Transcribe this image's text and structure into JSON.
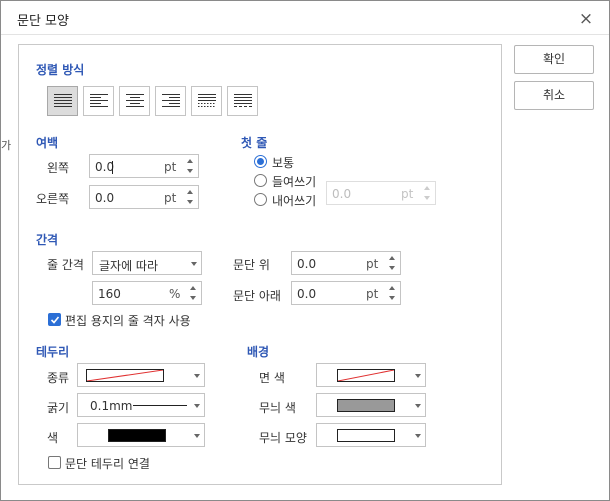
{
  "dialog": {
    "title": "문단 모양",
    "close_icon": "×"
  },
  "buttons": {
    "ok": "확인",
    "cancel": "취소"
  },
  "alignment": {
    "heading": "정렬 방식",
    "options": [
      "justify",
      "left",
      "center",
      "right",
      "distribute",
      "divide"
    ],
    "selected": "justify"
  },
  "margin": {
    "heading": "여백",
    "left": {
      "label": "왼쪽",
      "value": "0.0",
      "unit": "pt"
    },
    "right": {
      "label": "오른쪽",
      "value": "0.0",
      "unit": "pt"
    }
  },
  "first_line": {
    "heading": "첫 줄",
    "options": [
      "보통",
      "들여쓰기",
      "내어쓰기"
    ],
    "selected": "보통",
    "indent": {
      "value": "0.0",
      "unit": "pt"
    }
  },
  "spacing": {
    "heading": "간격",
    "line_spacing_label": "줄 간격",
    "line_spacing_type": "글자에 따라",
    "line_spacing_value": "160",
    "line_spacing_unit": "%",
    "above_label": "문단 위",
    "above_value": "0.0",
    "above_unit": "pt",
    "below_label": "문단 아래",
    "below_value": "0.0",
    "below_unit": "pt",
    "grid_checkbox_label": "편집 용지의 줄 격자 사용",
    "grid_checked": true
  },
  "border": {
    "heading": "테두리",
    "type_label": "종류",
    "thickness_label": "굵기",
    "thickness_value": "0.1mm",
    "color_label": "색",
    "connect_label": "문단 테두리 연결",
    "connect_checked": false,
    "color_hex": "#000000"
  },
  "background": {
    "heading": "배경",
    "face_color_label": "면 색",
    "pattern_color_label": "무늬 색",
    "pattern_shape_label": "무늬 모양",
    "pattern_color_hex": "#999999"
  },
  "edge_fragment": "가"
}
